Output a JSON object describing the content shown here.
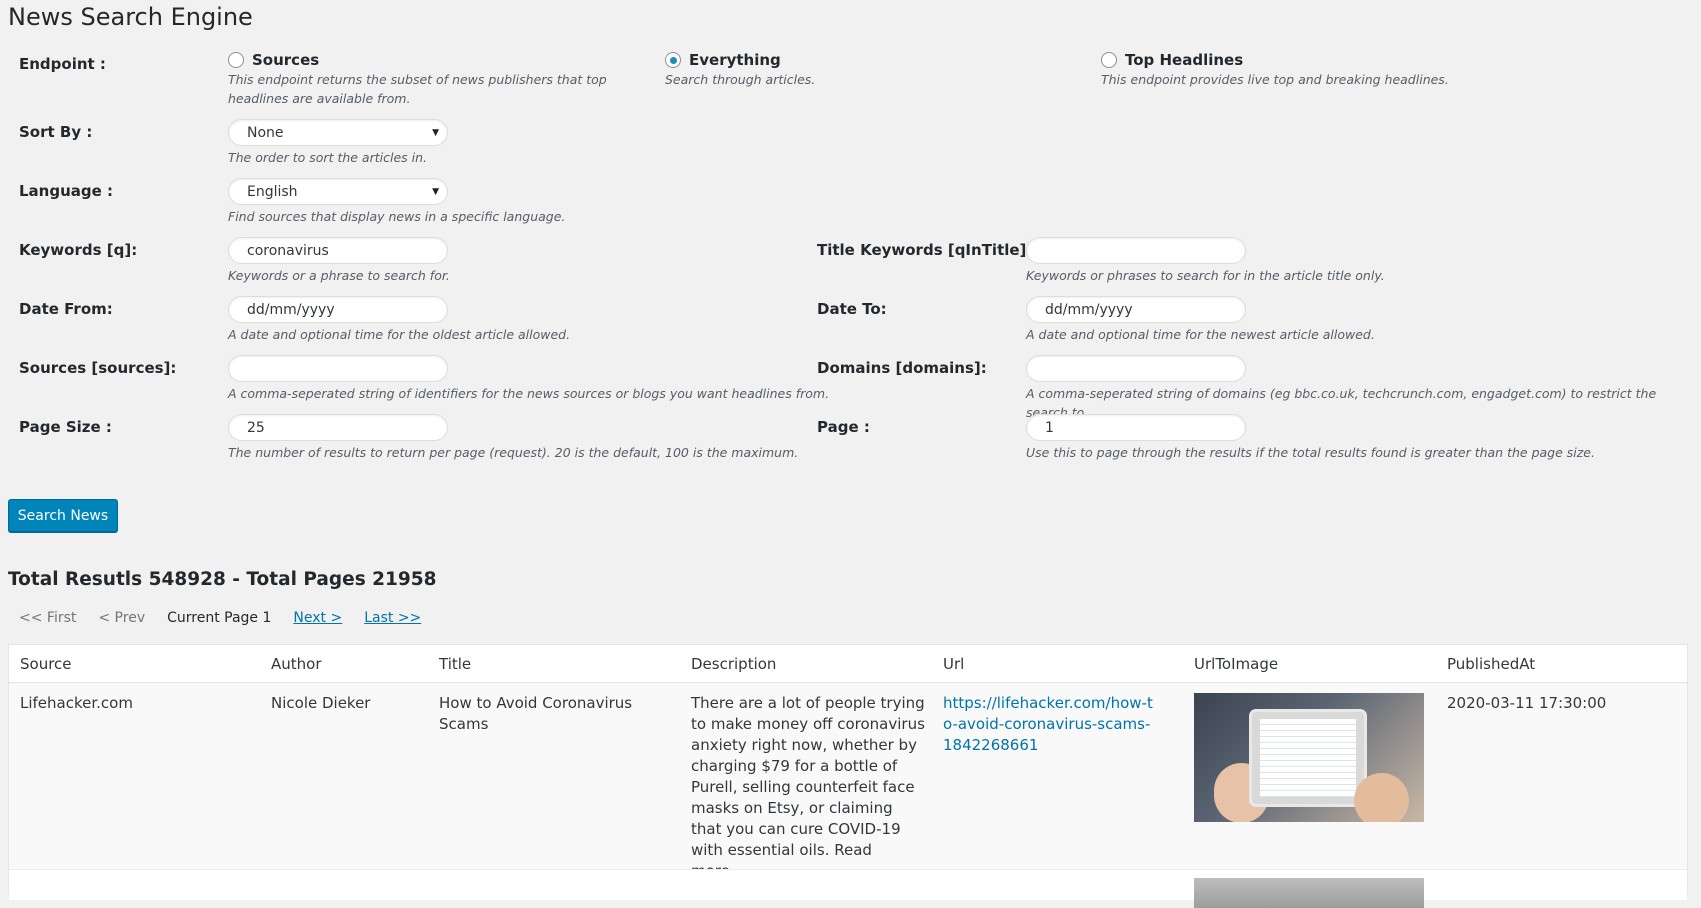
{
  "title": "News Search Engine",
  "endpoint": {
    "label": "Endpoint :",
    "options": [
      {
        "label": "Sources",
        "selected": false,
        "desc": "This endpoint returns the subset of news publishers that top headlines are available from."
      },
      {
        "label": "Everything",
        "selected": true,
        "desc": "Search through articles."
      },
      {
        "label": "Top Headlines",
        "selected": false,
        "desc": "This endpoint provides live top and breaking headlines."
      }
    ]
  },
  "sort_by": {
    "label": "Sort By :",
    "value": "None",
    "hint": "The order to sort the articles in."
  },
  "language": {
    "label": "Language :",
    "value": "English",
    "hint": "Find sources that display news in a specific language."
  },
  "keywords": {
    "label": "Keywords [q]:",
    "value": "coronavirus",
    "hint": "Keywords or a phrase to search for."
  },
  "title_keywords": {
    "label": "Title Keywords [qInTitle]:",
    "value": "",
    "hint": "Keywords or phrases to search for in the article title only."
  },
  "date_from": {
    "label": "Date From:",
    "value": "dd/mm/yyyy",
    "hint": "A date and optional time for the oldest article allowed."
  },
  "date_to": {
    "label": "Date To:",
    "value": "dd/mm/yyyy",
    "hint": "A date and optional time for the newest article allowed."
  },
  "sources": {
    "label": "Sources [sources]:",
    "value": "",
    "hint": "A comma-seperated string of identifiers for the news sources or blogs you want headlines from."
  },
  "domains": {
    "label": "Domains [domains]:",
    "value": "",
    "hint": "A comma-seperated string of domains (eg bbc.co.uk, techcrunch.com, engadget.com) to restrict the search to."
  },
  "page_size": {
    "label": "Page Size :",
    "value": "25",
    "hint": "The number of results to return per page (request). 20 is the default, 100 is the maximum."
  },
  "page": {
    "label": "Page :",
    "value": "1",
    "hint": "Use this to page through the results if the total results found is greater than the page size."
  },
  "search_button": "Search News",
  "totals": "Total Resutls 548928 - Total Pages 21958",
  "pager": {
    "first": "<< First",
    "prev": "< Prev",
    "current": "Current Page 1",
    "next": "Next >",
    "last": "Last >>"
  },
  "table": {
    "headers": [
      "Source",
      "Author",
      "Title",
      "Description",
      "Url",
      "UrlToImage",
      "PublishedAt"
    ],
    "rows": [
      {
        "source": "Lifehacker.com",
        "author": "Nicole Dieker",
        "title": "How to Avoid Coronavirus Scams",
        "description": "There are a lot of people trying to make money off coronavirus anxiety right now, whether by charging $79 for a bottle of Purell, selling counterfeit face masks on Etsy, or claiming that you can cure COVID-19 with essential oils. Read more...",
        "url": "https://lifehacker.com/how-to-avoid-coronavirus-scams-1842268661",
        "published_at": "2020-03-11 17:30:00"
      }
    ]
  },
  "colors": {
    "accent": "#0085ba",
    "link": "#0073aa",
    "background": "#f1f1f1"
  }
}
